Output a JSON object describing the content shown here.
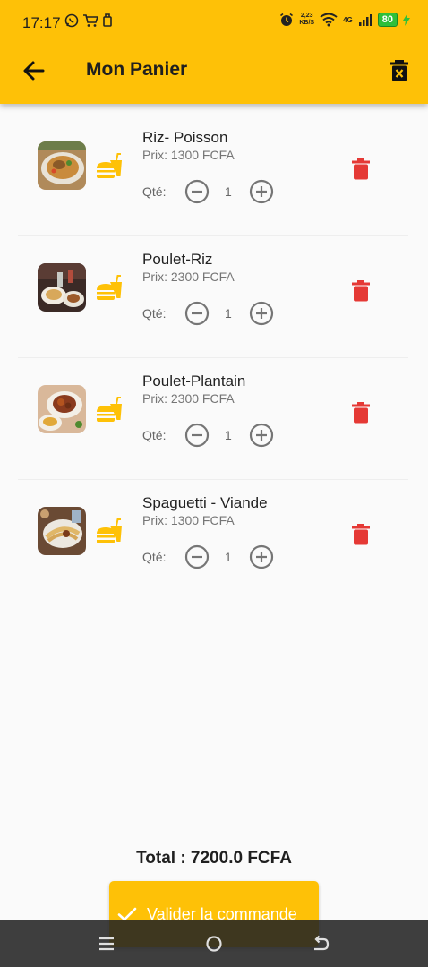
{
  "status": {
    "time": "17:17",
    "left_icons": [
      "whatsapp-icon",
      "shopping-cart-icon",
      "notification-icon"
    ],
    "speed_value": "2,23",
    "speed_unit": "KB/S",
    "network": "4G",
    "battery": "80"
  },
  "header": {
    "title": "Mon Panier"
  },
  "cart": {
    "qty_label": "Qté:",
    "items": [
      {
        "name": "Riz- Poisson",
        "price": "Prix: 1300 FCFA",
        "qty": "1"
      },
      {
        "name": "Poulet-Riz",
        "price": "Prix: 2300 FCFA",
        "qty": "1"
      },
      {
        "name": "Poulet-Plantain",
        "price": "Prix: 2300 FCFA",
        "qty": "1"
      },
      {
        "name": "Spaguetti - Viande",
        "price": "Prix: 1300 FCFA",
        "qty": "1"
      }
    ]
  },
  "footer": {
    "total": "Total : 7200.0 FCFA",
    "validate_label": "Valider la commande"
  },
  "colors": {
    "accent": "#fec107",
    "delete": "#e53935",
    "icon_gray": "#757575"
  }
}
